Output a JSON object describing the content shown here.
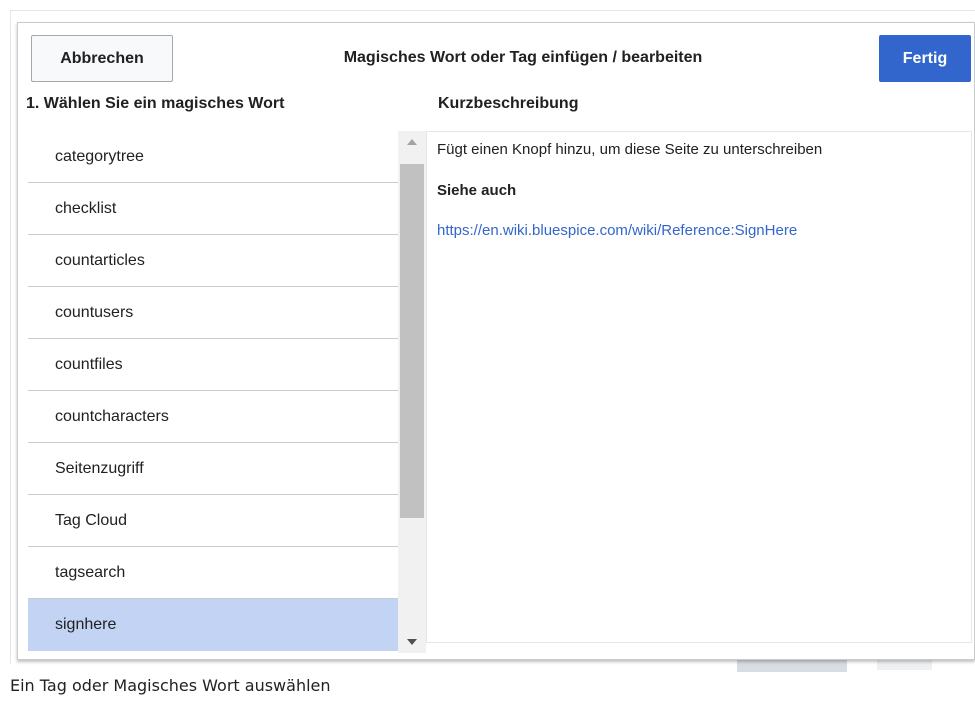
{
  "dialog": {
    "title": "Magisches Wort oder Tag einfügen / bearbeiten",
    "cancel_label": "Abbrechen",
    "done_label": "Fertig",
    "accent_color": "#3366cc"
  },
  "list_header": "1. Wählen Sie ein magisches Wort",
  "desc_header": "Kurzbeschreibung",
  "magic_words": [
    {
      "label": "categorytree"
    },
    {
      "label": "checklist"
    },
    {
      "label": "countarticles"
    },
    {
      "label": "countusers"
    },
    {
      "label": "countfiles"
    },
    {
      "label": "countcharacters"
    },
    {
      "label": "Seitenzugriff"
    },
    {
      "label": "Tag Cloud"
    },
    {
      "label": "tagsearch"
    },
    {
      "label": "signhere"
    }
  ],
  "selected_word": "signhere",
  "description": {
    "text": "Fügt einen Knopf hinzu, um diese Seite zu unterschreiben",
    "see_also_label": "Siehe auch",
    "link": "https://en.wiki.bluespice.com/wiki/Reference:SignHere"
  },
  "caption": "Ein Tag oder Magisches Wort auswählen"
}
